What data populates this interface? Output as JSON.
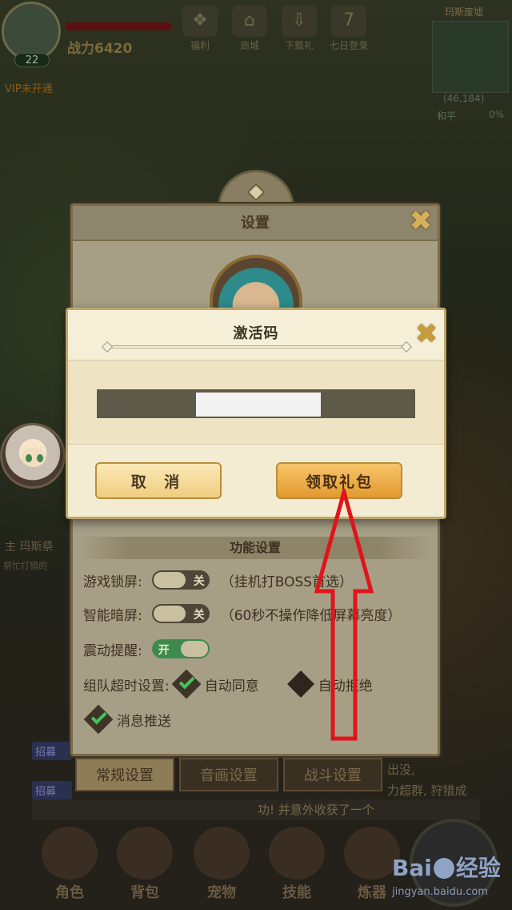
{
  "hud": {
    "level": "22",
    "power": "战力6420",
    "vip": "VIP未开通",
    "top_icons": [
      "福利",
      "商城",
      "下载礼",
      "七日登录"
    ],
    "top_right_label": "玛斯废墟",
    "coords": "(46,184)",
    "peace": "和平",
    "percent": "0%"
  },
  "background": {
    "left_chat_title": "主 玛斯祭",
    "left_chat_sub": "帮忙打猎的",
    "recruit_labels": [
      "招募",
      "招募"
    ],
    "bg_right_1": "出没,",
    "bg_right_2": "力超群, 狩猎成",
    "ticker": "功! 并意外收获了一个"
  },
  "settings": {
    "title": "设置",
    "section_title": "功能设置",
    "rows": [
      {
        "label": "游戏锁屏:",
        "toggle": "关",
        "hint": "（挂机打BOSS首选）"
      },
      {
        "label": "智能暗屏:",
        "toggle": "关",
        "hint": "（60秒不操作降低屏幕亮度）"
      },
      {
        "label": "震动提醒:",
        "toggle": "开"
      }
    ],
    "team_timeout_label": "组队超时设置:",
    "auto_agree": "自动同意",
    "auto_reject": "自动拒绝",
    "push": "消息推送",
    "tabs": [
      "常规设置",
      "音画设置",
      "战斗设置"
    ]
  },
  "dialog": {
    "title": "激活码",
    "cancel_label": "取 消",
    "claim_label": "领取礼包"
  },
  "bottom_nav": [
    "角色",
    "背包",
    "宠物",
    "技能",
    "炼器"
  ],
  "watermark": {
    "logo_left": "Bai",
    "logo_right": "经验",
    "url": "jingyan.baidu.com"
  },
  "colors": {
    "accent_gold": "#e29a30",
    "arrow_red": "#e0141a",
    "toggle_on": "#3e8a4e"
  }
}
